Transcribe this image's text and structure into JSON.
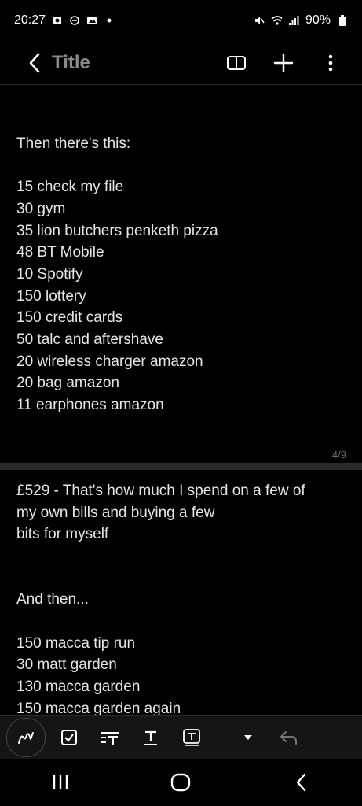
{
  "status_bar": {
    "time": "20:27",
    "battery": "90%",
    "icons": [
      "notification-icon",
      "dnd-icon",
      "gallery-icon",
      "dot-icon",
      "mute-icon",
      "wifi-icon",
      "signal-icon",
      "battery-icon"
    ]
  },
  "app_bar": {
    "title": "Title",
    "icons": [
      "back-icon",
      "book-icon",
      "add-icon",
      "more-icon"
    ]
  },
  "note": {
    "page1_lines": [
      "Then there's this:",
      "15 check my file",
      "30 gym",
      "35 lion butchers penketh pizza",
      "48 BT Mobile",
      "10 Spotify",
      "150 lottery",
      "150 credit cards",
      "50 talc and aftershave",
      "20 wireless charger amazon",
      "20 bag amazon",
      "11 earphones amazon"
    ],
    "page_indicator": "4/9",
    "page2_lines": [
      "£529 - That's how much I spend on a few of",
      "my own bills and buying a few",
      "bits for myself",
      "And then...",
      "150 macca tip run",
      "30 matt garden",
      "130 macca garden",
      "150 macca garden again"
    ]
  },
  "toolbar": {
    "tools": [
      "pen-icon",
      "checkbox-icon",
      "text-style-icon",
      "text-underline-icon",
      "text-box-icon",
      "dropdown-icon",
      "undo-icon"
    ]
  },
  "nav": {
    "buttons": [
      "recent-apps-icon",
      "home-icon",
      "back-nav-icon"
    ]
  }
}
